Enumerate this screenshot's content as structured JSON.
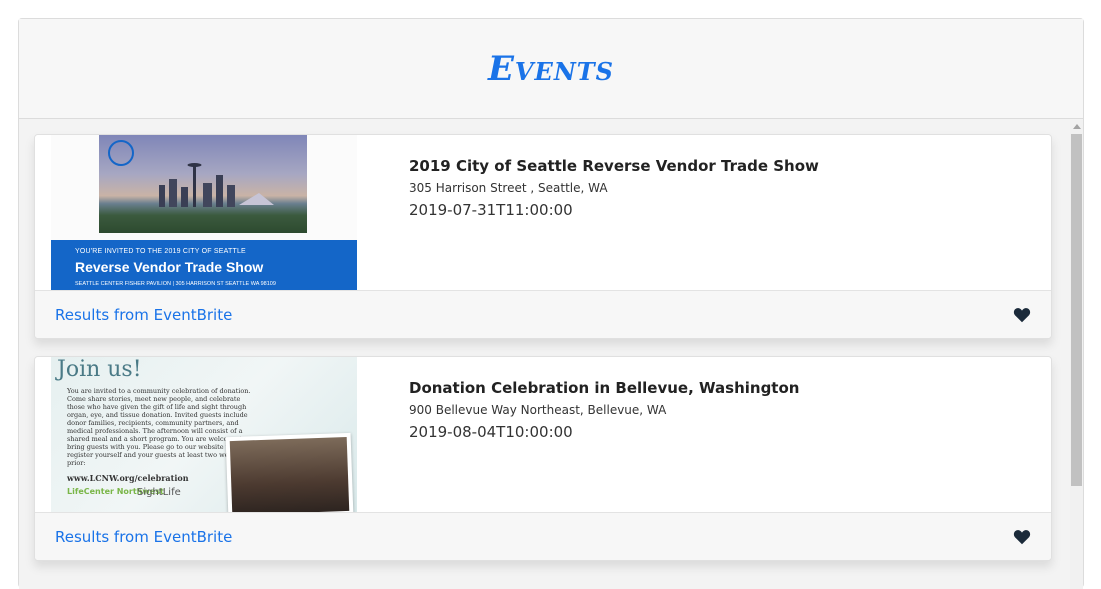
{
  "header": {
    "title": "Events"
  },
  "events": [
    {
      "title": "2019 City of Seattle Reverse Vendor Trade Show",
      "address": "305 Harrison Street , Seattle, WA",
      "datetime": "2019-07-31T11:00:00",
      "source_link": "Results from EventBrite",
      "icon": "heart-icon",
      "thumbnail": {
        "small": "YOU'RE INVITED TO THE 2019 CITY OF SEATTLE",
        "big": "Reverse Vendor Trade Show",
        "tiny": "SEATTLE CENTER FISHER PAVILION  |  305 HARRISON ST SEATTLE WA 98109"
      }
    },
    {
      "title": "Donation Celebration in Bellevue, Washington",
      "address": "900 Bellevue Way Northeast, Bellevue, WA",
      "datetime": "2019-08-04T10:00:00",
      "source_link": "Results from EventBrite",
      "icon": "heart-icon",
      "thumbnail": {
        "heading": "Join us!",
        "body": "You are invited to a community celebration of donation. Come share stories, meet new people, and celebrate those who have given the gift of life and sight through organ, eye, and tissue donation. Invited guests include donor families, recipients, community partners, and medical professionals. The afternoon will consist of a shared meal and a short program. You are welcome to bring guests with you. Please go to our website to register yourself and your guests at least two weeks prior:",
        "url": "www.LCNW.org/celebration",
        "logo1": "LifeCenter Northwest",
        "logo2": "SightLife"
      }
    }
  ],
  "colors": {
    "accent": "#1a73e8",
    "band": "#1466c8",
    "heart": "#1b2a3a"
  }
}
